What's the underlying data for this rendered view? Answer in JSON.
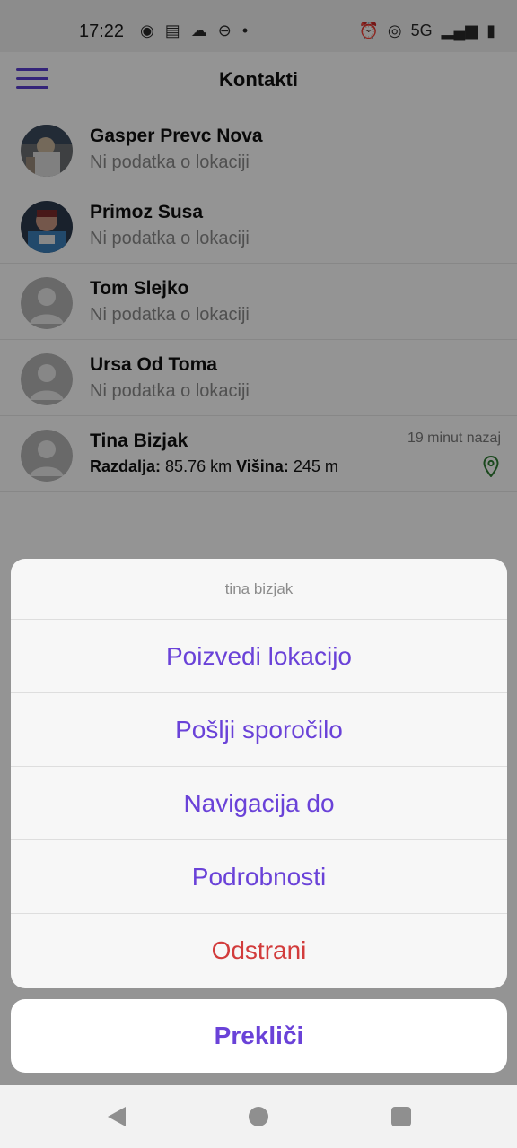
{
  "status_bar": {
    "time": "17:22",
    "network": "5G",
    "left_icons": [
      "record-icon",
      "notes-icon",
      "chat-icon",
      "steering-icon",
      "dot-icon"
    ],
    "right_icons": [
      "alarm-icon",
      "hotspot-icon",
      "signal-icon",
      "battery-icon"
    ]
  },
  "appbar": {
    "title": "Kontakti",
    "menu_icon": "hamburger-menu-icon"
  },
  "contacts": [
    {
      "name": "Gasper Prevc Nova",
      "status": "Ni podatka o lokaciji",
      "avatar": "photo"
    },
    {
      "name": "Primoz Susa",
      "status": "Ni podatka o lokaciji",
      "avatar": "photo"
    },
    {
      "name": "Tom Slejko",
      "status": "Ni podatka o lokaciji",
      "avatar": "placeholder"
    },
    {
      "name": "Ursa Od Toma",
      "status": "Ni podatka o lokaciji",
      "avatar": "placeholder"
    },
    {
      "name": "Tina Bizjak",
      "distance_label": "Razdalja:",
      "distance_value": "85.76 km",
      "altitude_label": "Višina:",
      "altitude_value": "245 m",
      "time_ago": "19 minut nazaj",
      "avatar": "placeholder",
      "icon": "location-pin-icon"
    }
  ],
  "action_sheet": {
    "title": "tina bizjak",
    "actions": [
      {
        "label": "Poizvedi lokacijo",
        "style": "normal"
      },
      {
        "label": "Pošlji sporočilo",
        "style": "normal"
      },
      {
        "label": "Navigacija do",
        "style": "normal"
      },
      {
        "label": "Podrobnosti",
        "style": "normal"
      },
      {
        "label": "Odstrani",
        "style": "danger"
      }
    ],
    "cancel_label": "Prekliči"
  },
  "colors": {
    "accent": "#6a42d8",
    "danger": "#d23c3c",
    "pin_green": "#2e7d32"
  }
}
